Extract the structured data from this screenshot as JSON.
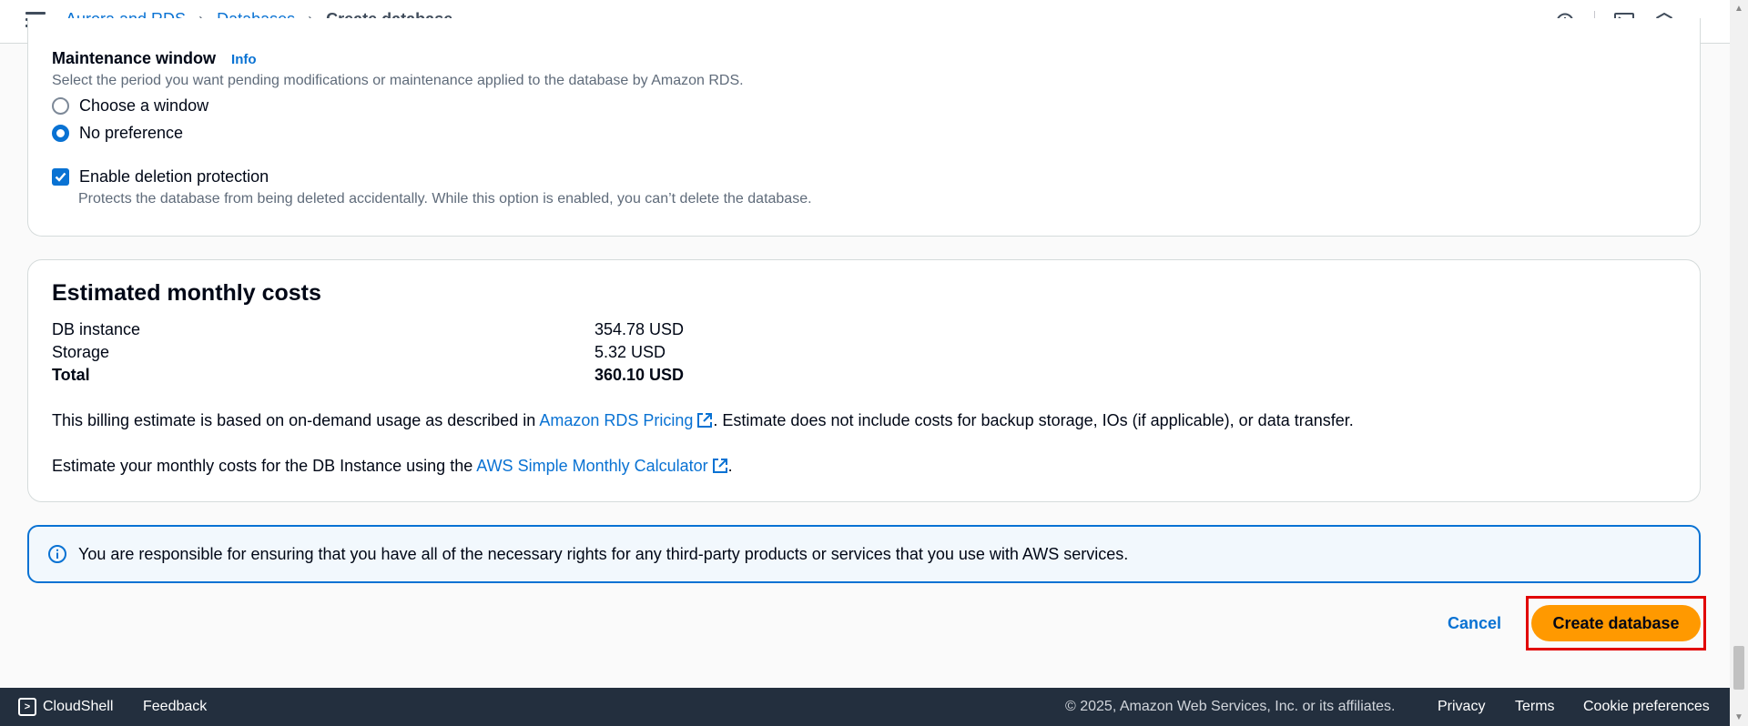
{
  "breadcrumb": {
    "items": [
      "Aurora and RDS",
      "Databases"
    ],
    "current": "Create database"
  },
  "maintenance": {
    "label": "Maintenance window",
    "info": "Info",
    "description": "Select the period you want pending modifications or maintenance applied to the database by Amazon RDS.",
    "options": [
      "Choose a window",
      "No preference"
    ],
    "selected": "No preference"
  },
  "deletion_protection": {
    "label": "Enable deletion protection",
    "checked": true,
    "description": "Protects the database from being deleted accidentally. While this option is enabled, you can’t delete the database."
  },
  "costs": {
    "title": "Estimated monthly costs",
    "rows": [
      {
        "label": "DB instance",
        "value": "354.78 USD"
      },
      {
        "label": "Storage",
        "value": "5.32 USD"
      },
      {
        "label": "Total",
        "value": "360.10 USD"
      }
    ],
    "billing_note_pre": "This billing estimate is based on on-demand usage as described in ",
    "billing_note_link": "Amazon RDS Pricing",
    "billing_note_post": ". Estimate does not include costs for backup storage, IOs (if applicable), or data transfer.",
    "calc_note_pre": "Estimate your monthly costs for the DB Instance using the ",
    "calc_note_link": "AWS Simple Monthly Calculator",
    "calc_note_post": "."
  },
  "alert": {
    "text": "You are responsible for ensuring that you have all of the necessary rights for any third-party products or services that you use with AWS services."
  },
  "actions": {
    "cancel": "Cancel",
    "create": "Create database"
  },
  "footer": {
    "cloudshell": "CloudShell",
    "feedback": "Feedback",
    "copyright": "© 2025, Amazon Web Services, Inc. or its affiliates.",
    "privacy": "Privacy",
    "terms": "Terms",
    "cookies": "Cookie preferences"
  },
  "icons": [
    "menu-icon",
    "info-circle-icon",
    "cloudshell-icon",
    "settings-icon",
    "external-link-icon",
    "check-icon"
  ],
  "colors": {
    "link": "#0972d3",
    "primary_button": "#ff9900",
    "footer_bg": "#232f3e",
    "highlight": "#e10000"
  }
}
